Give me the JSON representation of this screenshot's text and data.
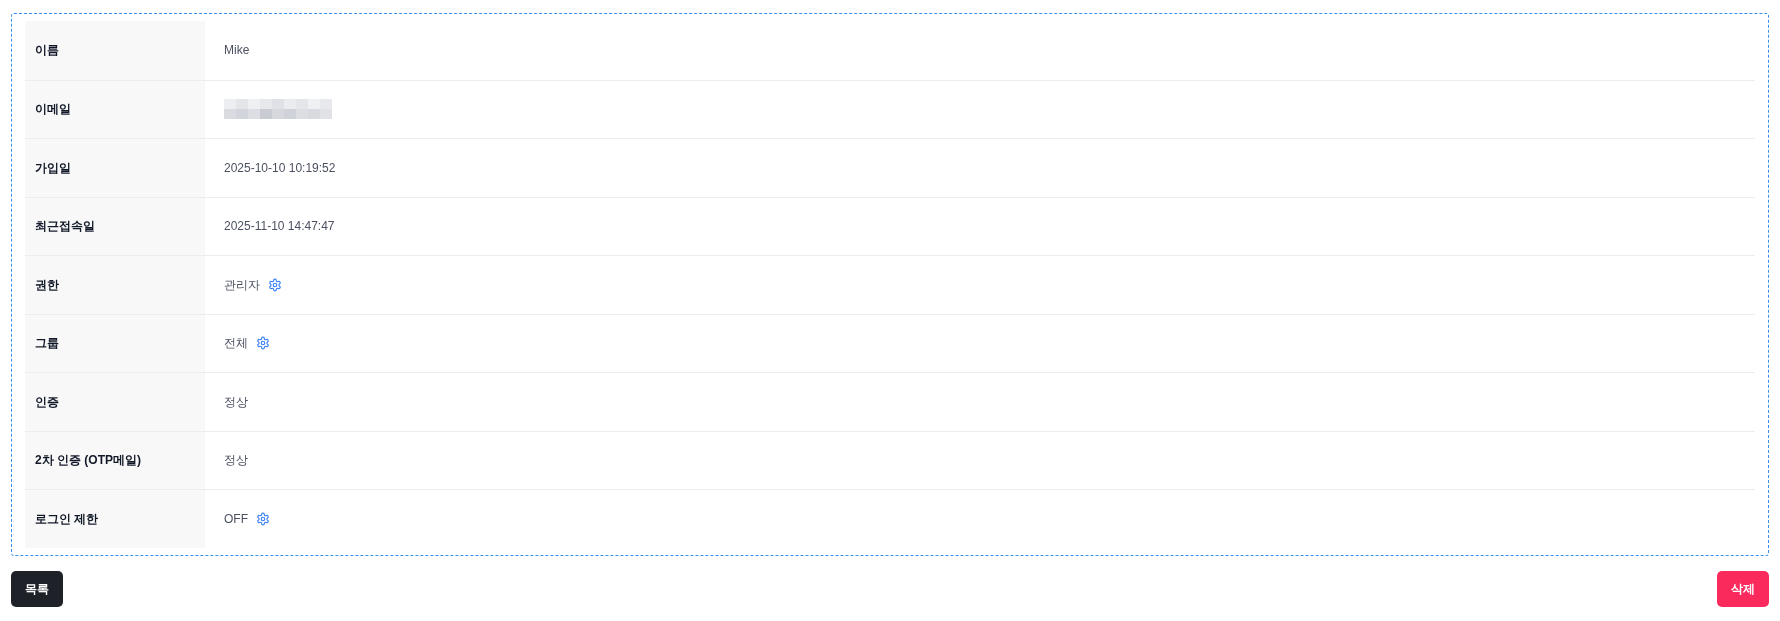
{
  "rows": [
    {
      "label": "이름",
      "kind": "text",
      "value": "Mike",
      "settings": false
    },
    {
      "label": "이메일",
      "kind": "redacted",
      "settings": false
    },
    {
      "label": "가입일",
      "kind": "text",
      "value": "2025-10-10 10:19:52",
      "settings": false
    },
    {
      "label": "최근접속일",
      "kind": "text",
      "value": "2025-11-10 14:47:47",
      "settings": false
    },
    {
      "label": "권한",
      "kind": "text",
      "value": "관리자",
      "settings": true
    },
    {
      "label": "그룹",
      "kind": "text",
      "value": "전체",
      "settings": true
    },
    {
      "label": "인증",
      "kind": "text",
      "value": "정상",
      "settings": false
    },
    {
      "label": "2차 인증 (OTP메일)",
      "kind": "text",
      "value": "정상",
      "settings": false
    },
    {
      "label": "로그인 제한",
      "kind": "text",
      "value": "OFF",
      "settings": true
    }
  ],
  "buttons": [
    {
      "label": "목록",
      "kind": "dark"
    },
    {
      "label": "삭제",
      "kind": "danger"
    }
  ]
}
